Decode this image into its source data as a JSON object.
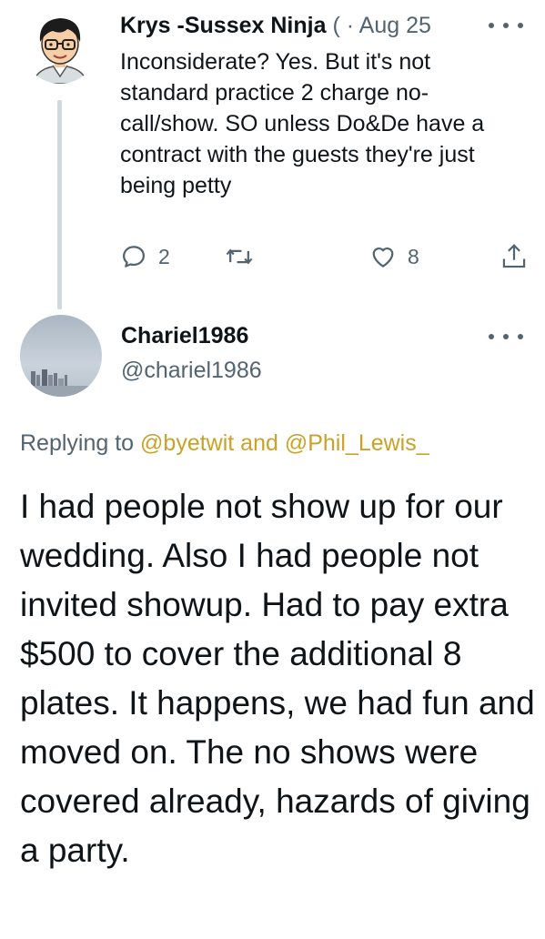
{
  "reply_tweet": {
    "author_name": "Krys -Sussex Ninja",
    "author_suffix": "(",
    "separator": "·",
    "date": "Aug 25",
    "text": "Inconsiderate? Yes. But it's not standard practice 2 charge no-call/show. SO unless Do&De have a contract with the guests they're just being petty",
    "reply_count": "2",
    "retweet_count": "",
    "like_count": "8",
    "icons": [
      "reply-icon",
      "retweet-icon",
      "like-icon",
      "share-icon",
      "more-icon"
    ]
  },
  "main_tweet": {
    "author_name": "Chariel1986",
    "author_handle": "@chariel1986",
    "replying_prefix": "Replying to",
    "replying_user1": "@byetwit",
    "replying_and": "and",
    "replying_user2": "@Phil_Lewis_",
    "text": "I had people not show up for our wedding.  Also I had people not invited showup. Had to pay extra $500 to cover the additional  8 plates. It happens, we had fun and moved on. The no shows were covered already, hazards of giving a party."
  },
  "colors": {
    "text_primary": "#0f1419",
    "text_secondary": "#536471",
    "mention": "#c9a227",
    "thread_line": "#cfd9de"
  }
}
